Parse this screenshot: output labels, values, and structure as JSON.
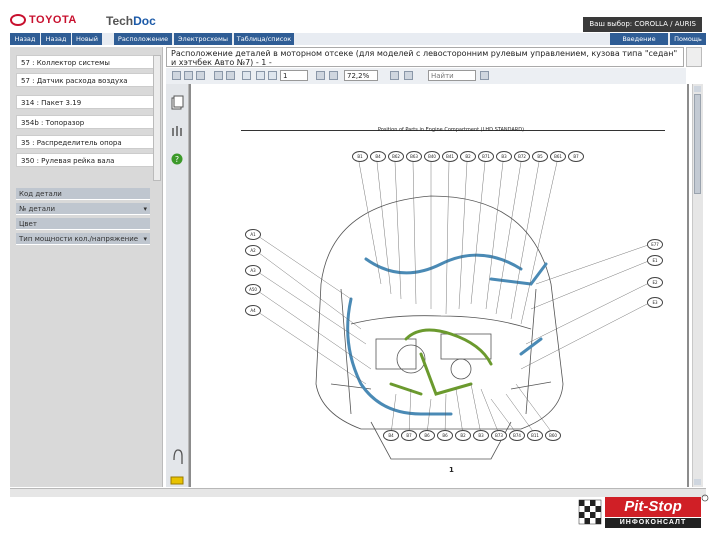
{
  "header": {
    "logo_text": "TOYOTA",
    "app_title_prefix": "Tech",
    "app_title_suffix": "Doc",
    "vehicle_label": "Ваш выбор: COROLLA / AURIS"
  },
  "nav": {
    "left": [
      "Назад",
      "Назад",
      "Новый"
    ],
    "tabs": [
      "Расположение",
      "Электросхемы",
      "Таблица/список"
    ],
    "right": [
      "Введение",
      "Помощь"
    ]
  },
  "sidebar": {
    "items": [
      "57 : Коллектор системы",
      "57 : Датчик расхода воздуха",
      "314 : Пакет 3.19",
      "354b : Топоразор",
      "35 : Распределитель опора",
      "350 : Рулевая рейка вала"
    ],
    "properties": [
      {
        "label": "Код детали",
        "arrow": ""
      },
      {
        "label": "№ детали",
        "arrow": "▾"
      },
      {
        "label": "Цвет",
        "arrow": ""
      },
      {
        "label": "Тип мощности кол./напряжение",
        "arrow": "▾"
      }
    ]
  },
  "document": {
    "title": "Расположение деталей в моторном отсеке (для моделей с левосторонним рулевым управлением, кузова типа \"седан\" и хэтчбек Авто №7) - 1 -",
    "page_number": "1",
    "zoom": "72,2%",
    "search_placeholder": "Найти",
    "drawing_title": "Position of Parts in Engine Compartment (LHD STANDARD)",
    "footer_page": "1",
    "top_callouts": [
      "B1",
      "B4",
      "B62",
      "B63",
      "B40",
      "B41",
      "B2",
      "B71",
      "B3",
      "B72",
      "B5",
      "B61",
      "B7"
    ],
    "left_callouts": [
      "A1",
      "A2",
      "A3",
      "A50",
      "A4"
    ],
    "right_callouts": [
      "E77",
      "E1",
      "E2",
      "E3"
    ],
    "bottom_callouts": [
      "B4",
      "B7",
      "B6",
      "B6",
      "B2",
      "B3",
      "B73",
      "B74",
      "B11",
      "B60"
    ]
  },
  "branding": {
    "name": "Pit-Stop",
    "subtitle": "ИНФОКОНСАЛТ"
  },
  "colors": {
    "nav_button": "#2f5d95",
    "harness_blue": "#4a8ab5",
    "harness_green": "#6b9a2e",
    "logo_red": "#c8102e",
    "pitstop_red": "#d01f26"
  }
}
